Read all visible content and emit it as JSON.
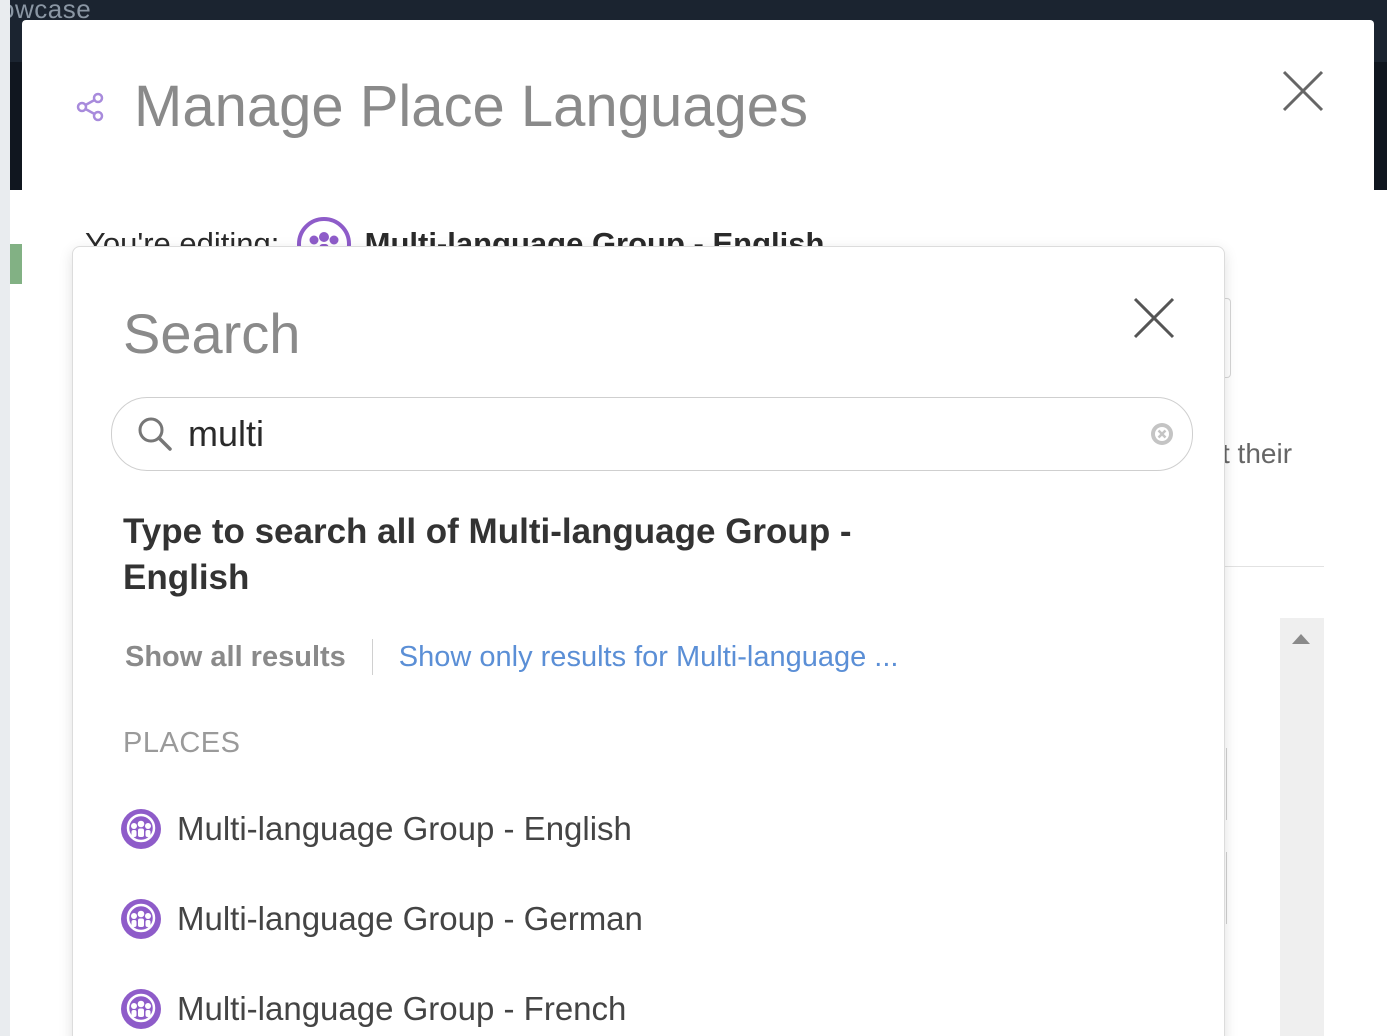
{
  "background": {
    "partial_text": "owcase"
  },
  "modal": {
    "title": "Manage Place Languages",
    "editing_label": "You're editing:",
    "editing_name": "Multi-language Group - English",
    "right_partial_text": "t their"
  },
  "search": {
    "title": "Search",
    "query": "multi",
    "hint": "Type to search all of Multi-language Group - English",
    "show_all": "Show all results",
    "show_only": "Show only results for Multi-language ...",
    "section_label": "PLACES",
    "results": [
      {
        "name": "Multi-language Group - English"
      },
      {
        "name": "Multi-language Group - German"
      },
      {
        "name": "Multi-language Group - French"
      }
    ]
  },
  "colors": {
    "accent_purple": "#8e5cc9",
    "link_blue": "#5b8fd6",
    "title_gray": "#8a8a8a"
  },
  "icons": {
    "share": "share-icon",
    "close": "close-icon",
    "search": "search-icon",
    "clear": "clear-icon",
    "group": "group-icon"
  }
}
